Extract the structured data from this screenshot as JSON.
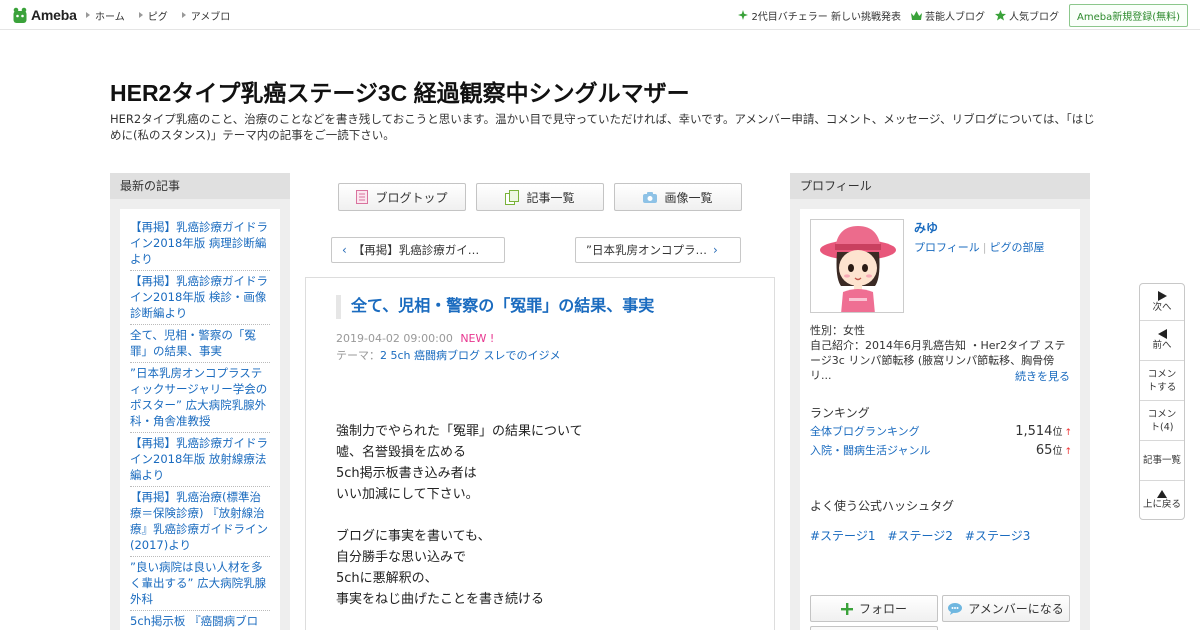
{
  "topbar": {
    "logo_text": "Ameba",
    "nav": [
      "ホーム",
      "ピグ",
      "アメブロ"
    ],
    "right_links": [
      "2代目バチェラー 新しい挑戦発表",
      "芸能人ブログ",
      "人気ブログ"
    ],
    "register_label": "Ameba新規登録(無料)"
  },
  "blog": {
    "title": "HER2タイプ乳癌ステージ3C 経過観察中シングルマザー",
    "description": "HER2タイプ乳癌のこと、治療のことなどを書き残しておこうと思います。温かい目で見守っていただければ、幸いです。アメンバー申請、コメント、メッセージ、リブログについては、「はじめに(私のスタンス)」テーマ内の記事をご一読下さい。"
  },
  "left": {
    "heading": "最新の記事",
    "articles": [
      "【再掲】乳癌診療ガイドライン2018年版 病理診断編より",
      "【再掲】乳癌診療ガイドライン2018年版 検診・画像診断編より",
      "全て、児相・警察の「冤罪」の結果、事実",
      "”日本乳房オンコプラスティックサージャリー学会のポスター” 広大病院乳腺外科・角舎准教授",
      "【再掲】乳癌診療ガイドライン2018年版 放射線療法編より",
      "【再掲】乳癌治療(標準治療＝保険診療) 『放射線治療』乳癌診療ガイドライン(2017)より",
      "”良い病院は良い人材を多く輩出する” 広大病院乳腺外科",
      "5ch掲示板 『癌闘病ブロ"
    ]
  },
  "center": {
    "buttons": [
      "ブログトップ",
      "記事一覧",
      "画像一覧"
    ],
    "prev_label": "【再掲】乳癌診療ガイ…",
    "next_label": "”日本乳房オンコプラ…",
    "entry": {
      "title": "全て、児相・警察の「冤罪」の結果、事実",
      "date": "2019-04-02 09:00:00",
      "new_badge": "NEW !",
      "theme_prefix": "テーマ：",
      "theme": "2 5ch 癌闘病ブログ スレでのイジメ",
      "paragraphs": [
        [
          "強制力でやられた「冤罪」の結果について",
          "嘘、名誉毀損を広める",
          "5ch掲示板書き込み者は",
          "いい加減にして下さい。"
        ],
        [
          "ブログに事実を書いても、",
          "自分勝手な思い込みで",
          "5chに悪解釈の、",
          "事実をねじ曲げたことを書き続ける"
        ]
      ]
    }
  },
  "right": {
    "heading": "プロフィール",
    "name": "みゆ",
    "links": [
      "プロフィール",
      "ピグの部屋"
    ],
    "gender": "性別：女性",
    "intro": "自己紹介：2014年6月乳癌告知 ・Her2タイプ ステージ3c リンパ節転移 (腋窩リンパ節転移、胸骨傍リ...",
    "more": "続きを見る",
    "ranking_heading": "ランキング",
    "rankings": [
      {
        "label": "全体ブログランキング",
        "value": "1,514",
        "unit": "位",
        "arrow": "↑"
      },
      {
        "label": "入院・闘病生活ジャンル",
        "value": "65",
        "unit": "位",
        "arrow": "↑"
      }
    ],
    "hashtag_heading": "よく使う公式ハッシュタグ",
    "hashtags": [
      "#ステージ1",
      "#ステージ2",
      "#ステージ3"
    ],
    "follow_label": "フォロー",
    "member_label": "アメンバーになる"
  },
  "sidenav": {
    "next": "次へ",
    "prev": "前へ",
    "comment": "コメントする",
    "comment_count": "コメント(4)",
    "list": "記事一覧",
    "top": "上に戻る"
  },
  "colors": {
    "link": "#1a6bbf",
    "new_badge": "#e8368f",
    "brand_green": "#2d8a2d"
  }
}
